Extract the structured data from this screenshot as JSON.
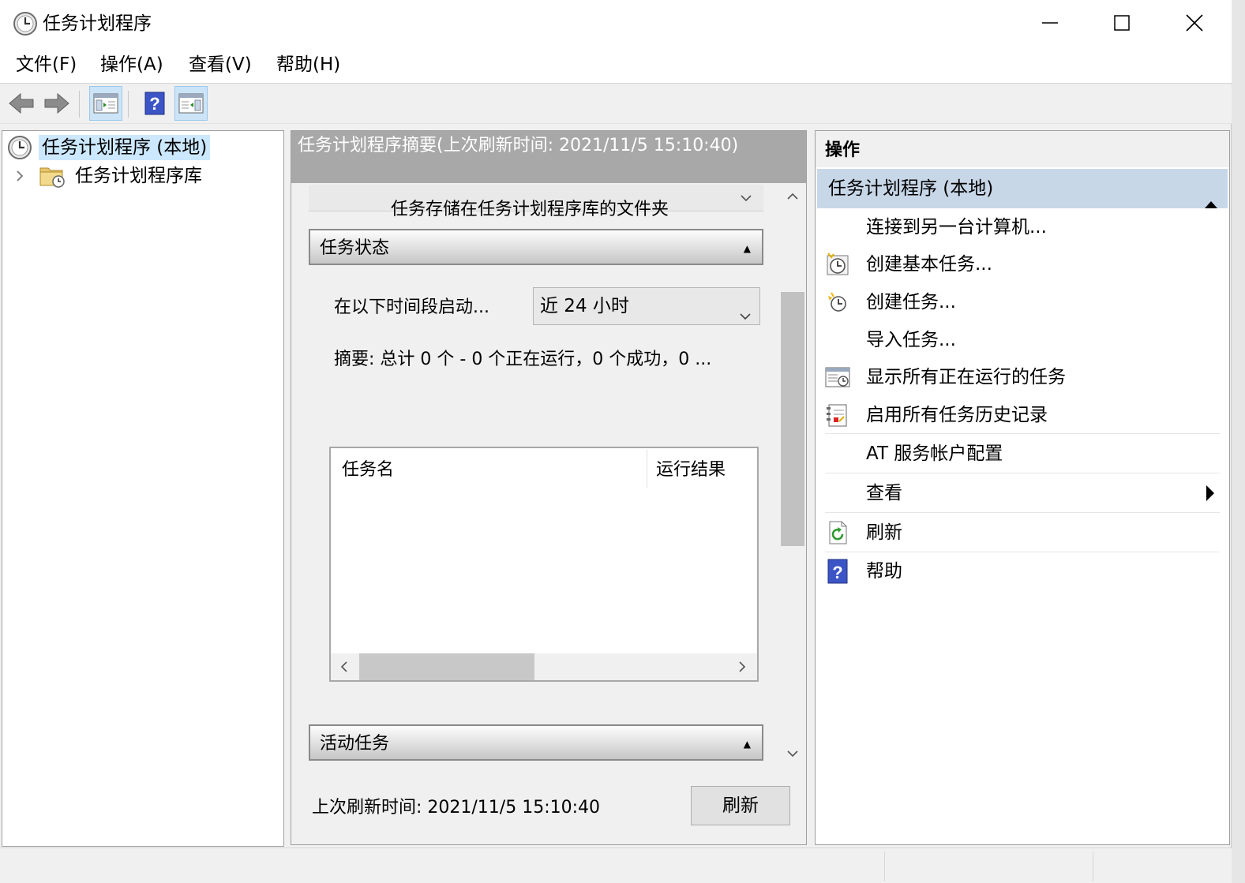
{
  "window": {
    "title": "任务计划程序",
    "icon": "clock-icon"
  },
  "menu": [
    "文件(F)",
    "操作(A)",
    "查看(V)",
    "帮助(H)"
  ],
  "toolbar": {
    "buttons": [
      "back-arrow-icon",
      "forward-arrow-icon",
      "show-hide-console-tree-icon",
      "help-icon",
      "show-hide-action-pane-icon"
    ]
  },
  "tree": {
    "root": "任务计划程序 (本地)",
    "child": "任务计划程序库"
  },
  "summary": {
    "header": "任务计划程序摘要(上次刷新时间: 2021/11/5 15:10:40)",
    "clipped_text": "任务存储在任务计划程序库的文件夹",
    "task_status": {
      "title": "任务状态",
      "period_label": "在以下时间段启动...",
      "period_value": "近 24 小时",
      "summary_line": "摘要: 总计 0 个 - 0 个正在运行，0 个成功，0 ...",
      "columns": [
        "任务名",
        "运行结果"
      ]
    },
    "active_tasks_title": "活动任务",
    "last_refresh": "上次刷新时间: 2021/11/5 15:10:40",
    "refresh_button": "刷新"
  },
  "actions": {
    "title": "操作",
    "group": "任务计划程序 (本地)",
    "items": [
      {
        "label": "连接到另一台计算机...",
        "icon": ""
      },
      {
        "label": "创建基本任务...",
        "icon": "create-basic-task-icon"
      },
      {
        "label": "创建任务...",
        "icon": "create-task-icon"
      },
      {
        "label": "导入任务...",
        "icon": ""
      },
      {
        "label": "显示所有正在运行的任务",
        "icon": "running-tasks-icon"
      },
      {
        "label": "启用所有任务历史记录",
        "icon": "history-icon"
      },
      {
        "label": "AT 服务帐户配置",
        "icon": ""
      },
      {
        "label": "查看",
        "icon": ""
      },
      {
        "label": "刷新",
        "icon": "refresh-icon"
      },
      {
        "label": "帮助",
        "icon": "help-icon"
      }
    ]
  }
}
